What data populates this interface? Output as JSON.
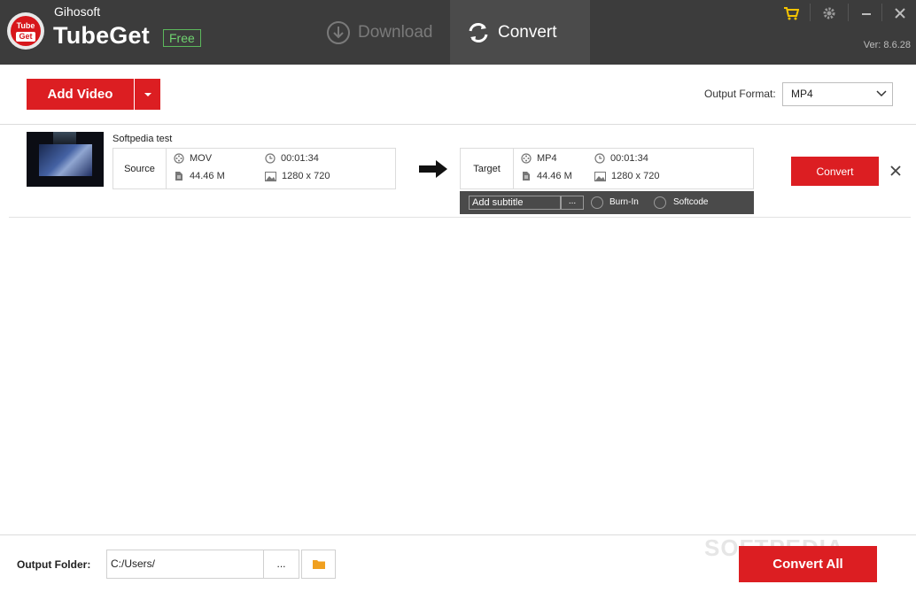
{
  "app": {
    "company": "Gihosoft",
    "name": "TubeGet",
    "badge": "Free",
    "logo_text_top": "Tube",
    "logo_text_bottom": "Get",
    "version": "Ver: 8.6.28"
  },
  "nav": {
    "download_label": "Download",
    "convert_label": "Convert",
    "active": "Convert"
  },
  "window_controls": {
    "cart_icon": "cart-icon",
    "settings_icon": "gear-icon",
    "minimize_icon": "minimize-icon",
    "close_icon": "close-icon"
  },
  "toolbar": {
    "add_video_label": "Add Video",
    "output_format_label": "Output Format:",
    "output_format_value": "MP4"
  },
  "items": [
    {
      "title": "Softpedia test",
      "source": {
        "label": "Source",
        "format": "MOV",
        "duration": "00:01:34",
        "size": "44.46 M",
        "resolution": "1280 x 720"
      },
      "target": {
        "label": "Target",
        "format": "MP4",
        "duration": "00:01:34",
        "size": "44.46 M",
        "resolution": "1280 x 720"
      },
      "subtitle": {
        "input_value": "Add subtitle",
        "browse_label": "...",
        "burn_in_label": "Burn-In",
        "softcode_label": "Softcode"
      },
      "convert_label": "Convert"
    }
  ],
  "footer": {
    "output_folder_label": "Output Folder:",
    "output_folder_value": "C:/Users/",
    "browse_label": "...",
    "convert_all_label": "Convert All"
  },
  "watermark": "SOFTPEDIA",
  "colors": {
    "accent_red": "#dc1e22",
    "titlebar": "#3c3c3c",
    "free_badge": "#5cb85c",
    "cart_yellow": "#f5c400",
    "folder_orange": "#f0a020"
  }
}
